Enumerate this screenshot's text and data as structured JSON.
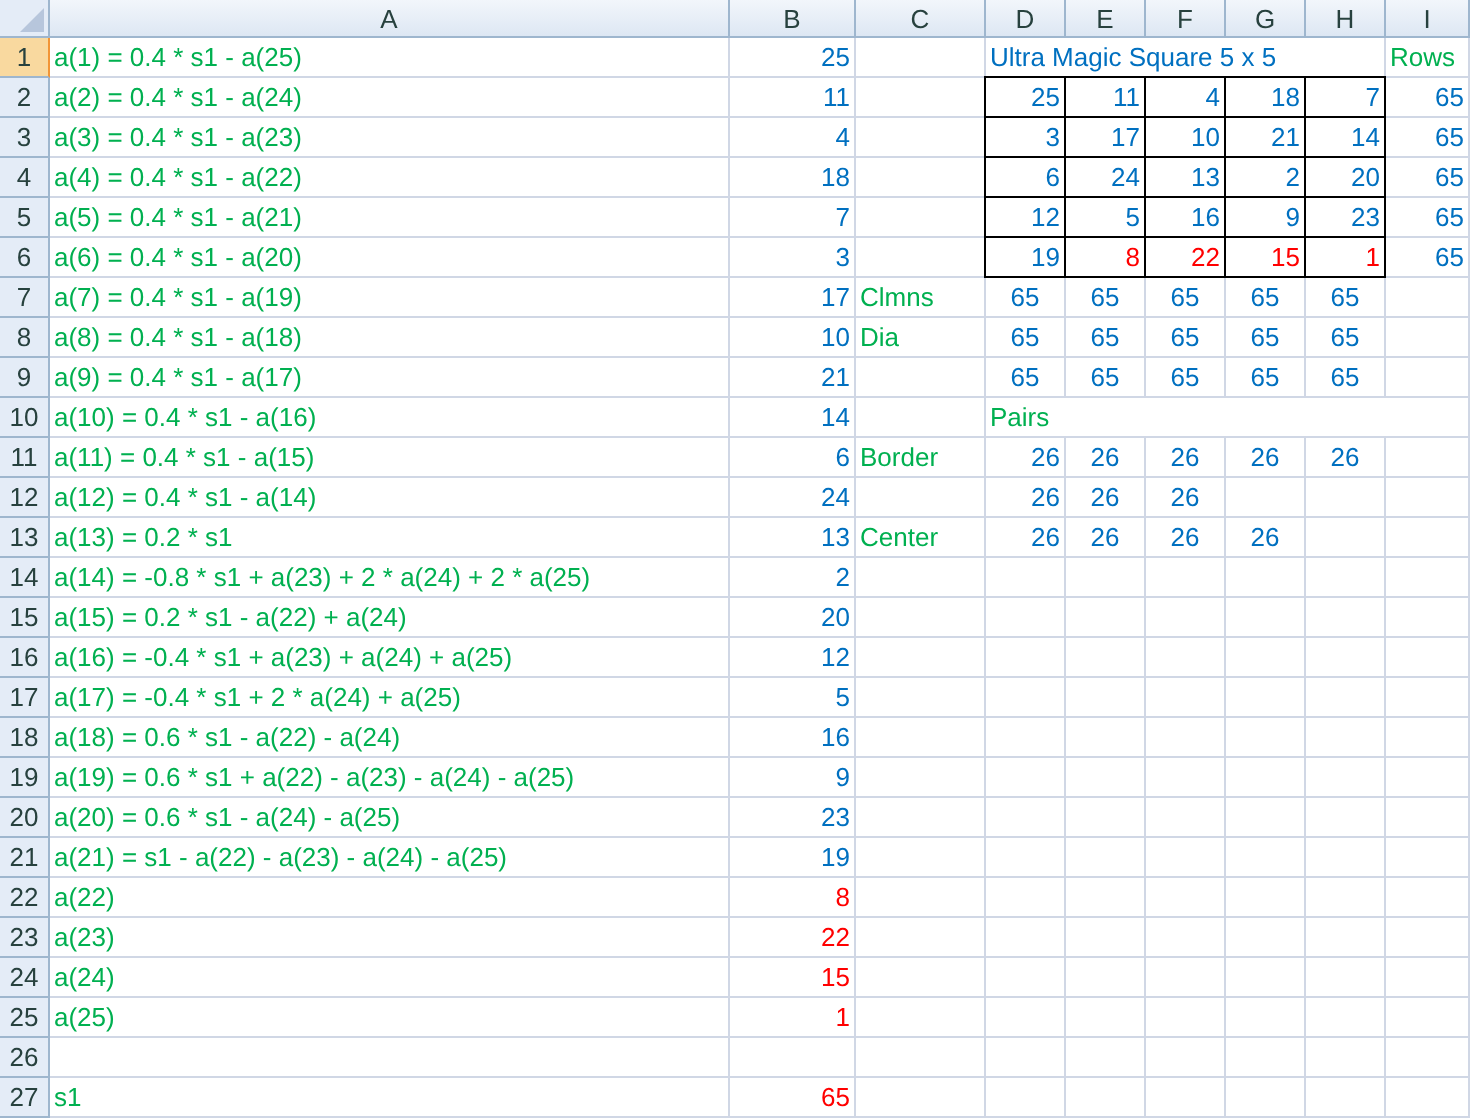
{
  "columns": [
    {
      "label": "A"
    },
    {
      "label": "B"
    },
    {
      "label": "C"
    },
    {
      "label": "D"
    },
    {
      "label": "E"
    },
    {
      "label": "F"
    },
    {
      "label": "G"
    },
    {
      "label": "H"
    },
    {
      "label": "I"
    }
  ],
  "rows": [
    {
      "num": "1",
      "selected": true,
      "cells": [
        {
          "text": "a(1) = 0.4 * s1 - a(25)",
          "color": "#00b050",
          "kind": "label"
        },
        {
          "text": "25",
          "color": "#0070c0",
          "kind": "number"
        },
        null,
        {
          "text": "Ultra Magic Square 5 x 5",
          "color": "#0070c0",
          "kind": "label"
        },
        null,
        null,
        null,
        null,
        {
          "text": "Rows",
          "color": "#00b050",
          "kind": "label"
        }
      ]
    },
    {
      "num": "2",
      "selected": false,
      "cells": [
        {
          "text": "a(2) = 0.4 * s1 - a(24)",
          "color": "#00b050",
          "kind": "label"
        },
        {
          "text": "11",
          "color": "#0070c0",
          "kind": "number"
        },
        null,
        {
          "text": "25",
          "color": "#0070c0",
          "kind": "number",
          "border": true
        },
        {
          "text": "11",
          "color": "#0070c0",
          "kind": "number",
          "border": true
        },
        {
          "text": "4",
          "color": "#0070c0",
          "kind": "number",
          "border": true
        },
        {
          "text": "18",
          "color": "#0070c0",
          "kind": "number",
          "border": true
        },
        {
          "text": "7",
          "color": "#0070c0",
          "kind": "number",
          "border": true
        },
        {
          "text": "65",
          "color": "#0070c0",
          "kind": "number"
        }
      ]
    },
    {
      "num": "3",
      "selected": false,
      "cells": [
        {
          "text": "a(3) = 0.4 * s1 - a(23)",
          "color": "#00b050",
          "kind": "label"
        },
        {
          "text": "4",
          "color": "#0070c0",
          "kind": "number"
        },
        null,
        {
          "text": "3",
          "color": "#0070c0",
          "kind": "number",
          "border": true
        },
        {
          "text": "17",
          "color": "#0070c0",
          "kind": "number",
          "border": true
        },
        {
          "text": "10",
          "color": "#0070c0",
          "kind": "number",
          "border": true
        },
        {
          "text": "21",
          "color": "#0070c0",
          "kind": "number",
          "border": true
        },
        {
          "text": "14",
          "color": "#0070c0",
          "kind": "number",
          "border": true
        },
        {
          "text": "65",
          "color": "#0070c0",
          "kind": "number"
        }
      ]
    },
    {
      "num": "4",
      "selected": false,
      "cells": [
        {
          "text": "a(4) = 0.4 * s1 - a(22)",
          "color": "#00b050",
          "kind": "label"
        },
        {
          "text": "18",
          "color": "#0070c0",
          "kind": "number"
        },
        null,
        {
          "text": "6",
          "color": "#0070c0",
          "kind": "number",
          "border": true
        },
        {
          "text": "24",
          "color": "#0070c0",
          "kind": "number",
          "border": true
        },
        {
          "text": "13",
          "color": "#0070c0",
          "kind": "number",
          "border": true
        },
        {
          "text": "2",
          "color": "#0070c0",
          "kind": "number",
          "border": true
        },
        {
          "text": "20",
          "color": "#0070c0",
          "kind": "number",
          "border": true
        },
        {
          "text": "65",
          "color": "#0070c0",
          "kind": "number"
        }
      ]
    },
    {
      "num": "5",
      "selected": false,
      "cells": [
        {
          "text": "a(5) = 0.4 * s1 - a(21)",
          "color": "#00b050",
          "kind": "label"
        },
        {
          "text": "7",
          "color": "#0070c0",
          "kind": "number"
        },
        null,
        {
          "text": "12",
          "color": "#0070c0",
          "kind": "number",
          "border": true
        },
        {
          "text": "5",
          "color": "#0070c0",
          "kind": "number",
          "border": true
        },
        {
          "text": "16",
          "color": "#0070c0",
          "kind": "number",
          "border": true
        },
        {
          "text": "9",
          "color": "#0070c0",
          "kind": "number",
          "border": true
        },
        {
          "text": "23",
          "color": "#0070c0",
          "kind": "number",
          "border": true
        },
        {
          "text": "65",
          "color": "#0070c0",
          "kind": "number"
        }
      ]
    },
    {
      "num": "6",
      "selected": false,
      "cells": [
        {
          "text": "a(6) = 0.4 * s1 - a(20)",
          "color": "#00b050",
          "kind": "label"
        },
        {
          "text": "3",
          "color": "#0070c0",
          "kind": "number"
        },
        null,
        {
          "text": "19",
          "color": "#0070c0",
          "kind": "number",
          "border": true
        },
        {
          "text": "8",
          "color": "#ff0000",
          "kind": "number",
          "border": true
        },
        {
          "text": "22",
          "color": "#ff0000",
          "kind": "number",
          "border": true
        },
        {
          "text": "15",
          "color": "#ff0000",
          "kind": "number",
          "border": true
        },
        {
          "text": "1",
          "color": "#ff0000",
          "kind": "number",
          "border": true
        },
        {
          "text": "65",
          "color": "#0070c0",
          "kind": "number"
        }
      ]
    },
    {
      "num": "7",
      "selected": false,
      "cells": [
        {
          "text": "a(7) = 0.4 * s1 - a(19)",
          "color": "#00b050",
          "kind": "label"
        },
        {
          "text": "17",
          "color": "#0070c0",
          "kind": "number"
        },
        {
          "text": "Clmns",
          "color": "#00b050",
          "kind": "label"
        },
        {
          "text": "65",
          "color": "#0070c0",
          "kind": "sum"
        },
        {
          "text": "65",
          "color": "#0070c0",
          "kind": "sum"
        },
        {
          "text": "65",
          "color": "#0070c0",
          "kind": "sum"
        },
        {
          "text": "65",
          "color": "#0070c0",
          "kind": "sum"
        },
        {
          "text": "65",
          "color": "#0070c0",
          "kind": "sum"
        },
        null
      ]
    },
    {
      "num": "8",
      "selected": false,
      "cells": [
        {
          "text": "a(8) = 0.4 * s1 - a(18)",
          "color": "#00b050",
          "kind": "label"
        },
        {
          "text": "10",
          "color": "#0070c0",
          "kind": "number"
        },
        {
          "text": "Dia",
          "color": "#00b050",
          "kind": "label"
        },
        {
          "text": "65",
          "color": "#0070c0",
          "kind": "sum"
        },
        {
          "text": "65",
          "color": "#0070c0",
          "kind": "sum"
        },
        {
          "text": "65",
          "color": "#0070c0",
          "kind": "sum"
        },
        {
          "text": "65",
          "color": "#0070c0",
          "kind": "sum"
        },
        {
          "text": "65",
          "color": "#0070c0",
          "kind": "sum"
        },
        null
      ]
    },
    {
      "num": "9",
      "selected": false,
      "cells": [
        {
          "text": "a(9) = 0.4 * s1 - a(17)",
          "color": "#00b050",
          "kind": "label"
        },
        {
          "text": "21",
          "color": "#0070c0",
          "kind": "number"
        },
        null,
        {
          "text": "65",
          "color": "#0070c0",
          "kind": "sum"
        },
        {
          "text": "65",
          "color": "#0070c0",
          "kind": "sum"
        },
        {
          "text": "65",
          "color": "#0070c0",
          "kind": "sum"
        },
        {
          "text": "65",
          "color": "#0070c0",
          "kind": "sum"
        },
        {
          "text": "65",
          "color": "#0070c0",
          "kind": "sum"
        },
        null
      ]
    },
    {
      "num": "10",
      "selected": false,
      "cells": [
        {
          "text": "a(10) = 0.4 * s1 - a(16)",
          "color": "#00b050",
          "kind": "label"
        },
        {
          "text": "14",
          "color": "#0070c0",
          "kind": "number"
        },
        null,
        {
          "text": "Pairs",
          "color": "#00b050",
          "kind": "label"
        },
        null,
        null,
        null,
        null,
        null
      ]
    },
    {
      "num": "11",
      "selected": false,
      "cells": [
        {
          "text": "a(11) = 0.4 * s1 - a(15)",
          "color": "#00b050",
          "kind": "label"
        },
        {
          "text": "6",
          "color": "#0070c0",
          "kind": "number"
        },
        {
          "text": "Border",
          "color": "#00b050",
          "kind": "label"
        },
        {
          "text": "26",
          "color": "#0070c0",
          "kind": "number"
        },
        {
          "text": "26",
          "color": "#0070c0",
          "kind": "sum"
        },
        {
          "text": "26",
          "color": "#0070c0",
          "kind": "sum"
        },
        {
          "text": "26",
          "color": "#0070c0",
          "kind": "sum"
        },
        {
          "text": "26",
          "color": "#0070c0",
          "kind": "sum"
        },
        null
      ]
    },
    {
      "num": "12",
      "selected": false,
      "cells": [
        {
          "text": "a(12) = 0.4 * s1 - a(14)",
          "color": "#00b050",
          "kind": "label"
        },
        {
          "text": "24",
          "color": "#0070c0",
          "kind": "number"
        },
        null,
        {
          "text": "26",
          "color": "#0070c0",
          "kind": "number"
        },
        {
          "text": "26",
          "color": "#0070c0",
          "kind": "sum"
        },
        {
          "text": "26",
          "color": "#0070c0",
          "kind": "sum"
        },
        null,
        null,
        null
      ]
    },
    {
      "num": "13",
      "selected": false,
      "cells": [
        {
          "text": "a(13) = 0.2 * s1",
          "color": "#00b050",
          "kind": "label"
        },
        {
          "text": "13",
          "color": "#0070c0",
          "kind": "number"
        },
        {
          "text": "Center",
          "color": "#00b050",
          "kind": "label"
        },
        {
          "text": "26",
          "color": "#0070c0",
          "kind": "number"
        },
        {
          "text": "26",
          "color": "#0070c0",
          "kind": "sum"
        },
        {
          "text": "26",
          "color": "#0070c0",
          "kind": "sum"
        },
        {
          "text": "26",
          "color": "#0070c0",
          "kind": "sum"
        },
        null,
        null
      ]
    },
    {
      "num": "14",
      "selected": false,
      "cells": [
        {
          "text": "a(14) = -0.8 * s1 + a(23) + 2 * a(24) + 2 * a(25)",
          "color": "#00b050",
          "kind": "label"
        },
        {
          "text": "2",
          "color": "#0070c0",
          "kind": "number"
        },
        null,
        null,
        null,
        null,
        null,
        null,
        null
      ]
    },
    {
      "num": "15",
      "selected": false,
      "cells": [
        {
          "text": "a(15) = 0.2 * s1 - a(22) + a(24)",
          "color": "#00b050",
          "kind": "label"
        },
        {
          "text": "20",
          "color": "#0070c0",
          "kind": "number"
        },
        null,
        null,
        null,
        null,
        null,
        null,
        null
      ]
    },
    {
      "num": "16",
      "selected": false,
      "cells": [
        {
          "text": "a(16) = -0.4 * s1 + a(23) + a(24) + a(25)",
          "color": "#00b050",
          "kind": "label"
        },
        {
          "text": "12",
          "color": "#0070c0",
          "kind": "number"
        },
        null,
        null,
        null,
        null,
        null,
        null,
        null
      ]
    },
    {
      "num": "17",
      "selected": false,
      "cells": [
        {
          "text": "a(17) = -0.4 * s1 + 2 * a(24) + a(25)",
          "color": "#00b050",
          "kind": "label"
        },
        {
          "text": "5",
          "color": "#0070c0",
          "kind": "number"
        },
        null,
        null,
        null,
        null,
        null,
        null,
        null
      ]
    },
    {
      "num": "18",
      "selected": false,
      "cells": [
        {
          "text": "a(18) = 0.6 * s1 - a(22) - a(24)",
          "color": "#00b050",
          "kind": "label"
        },
        {
          "text": "16",
          "color": "#0070c0",
          "kind": "number"
        },
        null,
        null,
        null,
        null,
        null,
        null,
        null
      ]
    },
    {
      "num": "19",
      "selected": false,
      "cells": [
        {
          "text": "a(19) = 0.6 * s1 + a(22) - a(23) - a(24) - a(25)",
          "color": "#00b050",
          "kind": "label"
        },
        {
          "text": "9",
          "color": "#0070c0",
          "kind": "number"
        },
        null,
        null,
        null,
        null,
        null,
        null,
        null
      ]
    },
    {
      "num": "20",
      "selected": false,
      "cells": [
        {
          "text": "a(20) = 0.6 * s1 - a(24) - a(25)",
          "color": "#00b050",
          "kind": "label"
        },
        {
          "text": "23",
          "color": "#0070c0",
          "kind": "number"
        },
        null,
        null,
        null,
        null,
        null,
        null,
        null
      ]
    },
    {
      "num": "21",
      "selected": false,
      "cells": [
        {
          "text": "a(21) = s1 - a(22) - a(23) - a(24) - a(25)",
          "color": "#00b050",
          "kind": "label"
        },
        {
          "text": "19",
          "color": "#0070c0",
          "kind": "number"
        },
        null,
        null,
        null,
        null,
        null,
        null,
        null
      ]
    },
    {
      "num": "22",
      "selected": false,
      "cells": [
        {
          "text": "a(22)",
          "color": "#00b050",
          "kind": "label"
        },
        {
          "text": "8",
          "color": "#ff0000",
          "kind": "number"
        },
        null,
        null,
        null,
        null,
        null,
        null,
        null
      ]
    },
    {
      "num": "23",
      "selected": false,
      "cells": [
        {
          "text": "a(23)",
          "color": "#00b050",
          "kind": "label"
        },
        {
          "text": "22",
          "color": "#ff0000",
          "kind": "number"
        },
        null,
        null,
        null,
        null,
        null,
        null,
        null
      ]
    },
    {
      "num": "24",
      "selected": false,
      "cells": [
        {
          "text": "a(24)",
          "color": "#00b050",
          "kind": "label"
        },
        {
          "text": "15",
          "color": "#ff0000",
          "kind": "number"
        },
        null,
        null,
        null,
        null,
        null,
        null,
        null
      ]
    },
    {
      "num": "25",
      "selected": false,
      "cells": [
        {
          "text": "a(25)",
          "color": "#00b050",
          "kind": "label"
        },
        {
          "text": "1",
          "color": "#ff0000",
          "kind": "number"
        },
        null,
        null,
        null,
        null,
        null,
        null,
        null
      ]
    },
    {
      "num": "26",
      "selected": false,
      "cells": [
        null,
        null,
        null,
        null,
        null,
        null,
        null,
        null,
        null
      ]
    },
    {
      "num": "27",
      "selected": false,
      "cells": [
        {
          "text": "s1",
          "color": "#00b050",
          "kind": "label"
        },
        {
          "text": "65",
          "color": "#ff0000",
          "kind": "number"
        },
        null,
        null,
        null,
        null,
        null,
        null,
        null
      ]
    }
  ]
}
